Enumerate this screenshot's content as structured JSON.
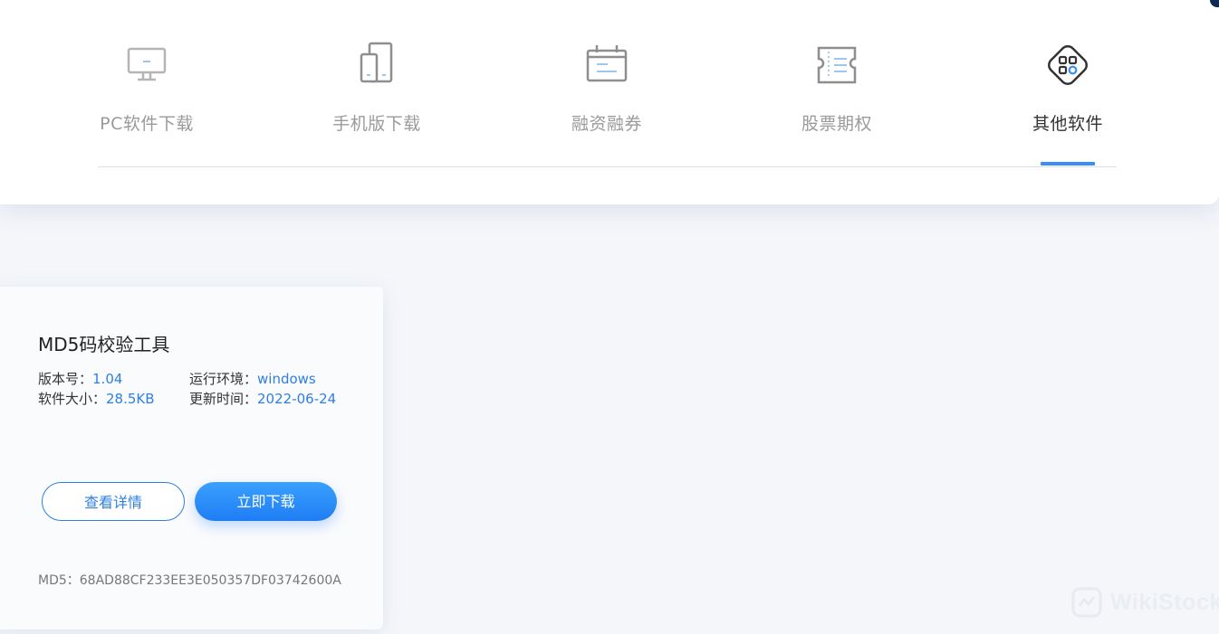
{
  "tabs": [
    {
      "label": "PC软件下载",
      "icon": "monitor-icon",
      "active": false
    },
    {
      "label": "手机版下载",
      "icon": "phone-icon",
      "active": false
    },
    {
      "label": "融资融券",
      "icon": "calendar-icon",
      "active": false
    },
    {
      "label": "股票期权",
      "icon": "ticket-icon",
      "active": false
    },
    {
      "label": "其他软件",
      "icon": "apps-icon",
      "active": true
    }
  ],
  "software": {
    "title": "MD5码校验工具",
    "version_label": "版本号：",
    "version_value": "1.04",
    "env_label": "运行环境：",
    "env_value": "windows",
    "size_label": "软件大小：",
    "size_value": "28.5KB",
    "updated_label": "更新时间：",
    "updated_value": "2022-06-24",
    "details_button": "查看详情",
    "download_button": "立即下载",
    "md5_text": "MD5：68AD88CF233EE3E050357DF03742600A"
  },
  "watermark": {
    "text": "WikiStock"
  },
  "colors": {
    "accent": "#3a8ef6",
    "link": "#2f7fe0",
    "tab_inactive": "#9a9a9a",
    "tab_active": "#333333"
  }
}
